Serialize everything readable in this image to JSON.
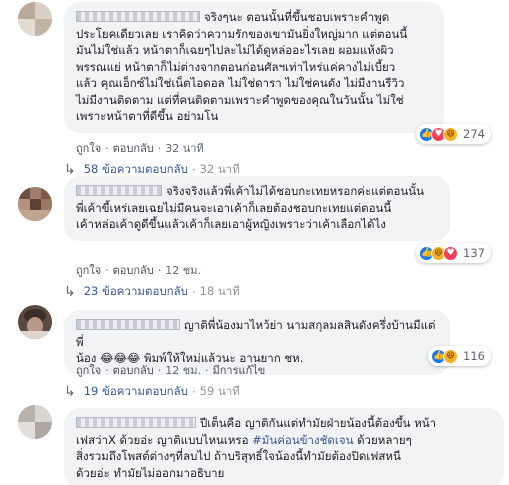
{
  "comments": [
    {
      "lines": [
        "จริงๆนะ ตอนนั้นที่ขึ้นชอบเพราะคำพูด",
        "ประโยคเดียวเลย เราคิดว่าความรักของเขามันยิ่งใหญ่มาก แต่ตอนนี้",
        "มันไม่ใช่แล้ว หน้าตาก็เฉยๆไปละไม่ได้ดูหล่ออะไรเลย ผอมแห้งผิว",
        "พรรณแย่ หน้าตาก็ไม่ต่างจากตอนก่อนศัลฯเท่าไหร่แค่คางไม่เบี้ยว",
        "แล้ว คุณเอ็กซ์ไม่ใช่เน็ตไอดอล ไม่ใช่ดารา ไม่ใช่คนดัง ไม่มีงานรีวิว",
        "ไม่มีงานติดตาม แต่ที่คนติดตามเพราะคำพูดของคุณในวันนั้น ไม่ใช่",
        "เพราะหน้าตาที่ดีขึ้น อย่ามโน"
      ],
      "reaction_count": "274",
      "like_label": "ถูกใจ",
      "reply_label": "ตอบกลับ",
      "time": "32 นาที",
      "replies_label": "58 ข้อความตอบกลับ",
      "replies_time": "32 นาที",
      "reactions": [
        "like",
        "love",
        "haha"
      ]
    },
    {
      "lines": [
        "จริงจริงแล้วพี่เค้าไม่ได้ชอบกะเทยหรอกค่ะแต่ตอนนั้น",
        "พี่เค้าขี้เหร่เลยเฉยไม่มีคนจะเอาเค้าก็เลยต้องชอบกะเทยแต่ตอนนี้",
        "เค้าหล่อเค้าดูดีขึ้นแล้วเค้าก็เลยเอาผู้หญิงเพราะว่าเค้าเลือกได้ไง"
      ],
      "reaction_count": "137",
      "like_label": "ถูกใจ",
      "reply_label": "ตอบกลับ",
      "time": "12 ชม.",
      "replies_label": "23 ข้อความตอบกลับ",
      "replies_time": "18 นาที",
      "reactions": [
        "like",
        "haha",
        "love"
      ]
    },
    {
      "lines": [
        "ญาติพี่น้องมาไหว้ย่า นามสกุลมลสินดังครึ่งบ้านมีแต่พี่",
        "น้อง 😂😂😂 พิมพ์ให้ใหม่แล้วนะ อานยาก ชห."
      ],
      "reaction_count": "116",
      "like_label": "ถูกใจ",
      "reply_label": "ตอบกลับ",
      "time": "12 ชม.",
      "edited_label": "มีการแก้ไข",
      "replies_label": "19 ข้อความตอบกลับ",
      "replies_time": "59 นาที",
      "reactions": [
        "like",
        "haha"
      ]
    },
    {
      "lines": [
        "ปีเต็นคือ ญาติกันแต่ทำมัยฝ่ายน้องนี้ต้องขึ้น หน้า",
        "เฟสว่าX ด้วยอ่ะ ญาติแบบไหนเหรอ",
        "สิ่งรวมถึงโพสต์ต่างๆที่ลบไป ถ้าบริสุทธิ์ใจน้องนี้ทำมัยต้องปิดเฟสหนี",
        "ด้วยอ่ะ ทำมัยไม่ออกมาอธิบาย"
      ],
      "hashtag": "#มันค่อนข้างชัดเจน",
      "line2_tail": "ด้วยหลายๆ"
    }
  ]
}
